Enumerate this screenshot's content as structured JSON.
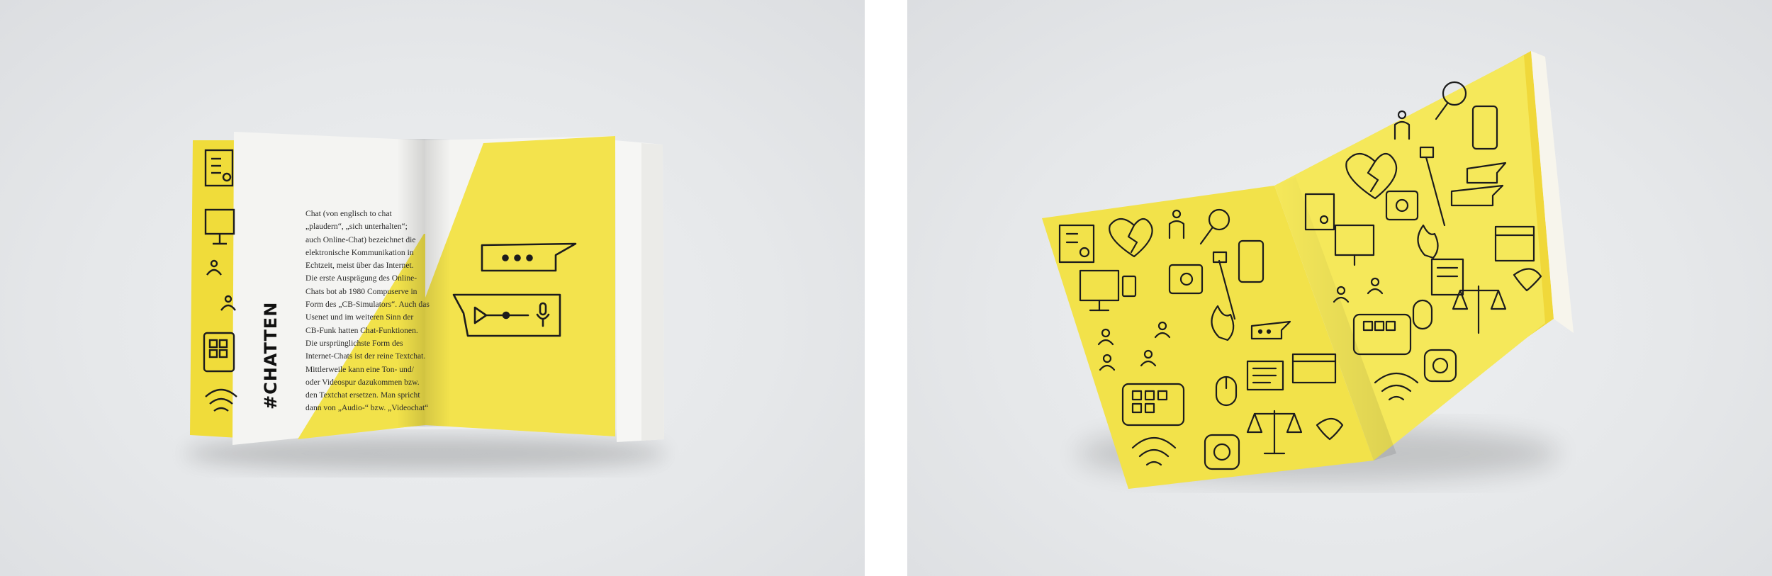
{
  "left_photo": {
    "heading": "#CHATTEN",
    "body_text": "Chat (von englisch to chat\n„plaudern“, „sich unterhalten“;\nauch Online-Chat) bezeichnet die\nelektronische Kommunikation in\nEchtzeit, meist über das Internet.\nDie erste Ausprägung des Online-\nChats bot ab 1980 Compuserve in\nForm des „CB-Simulators“. Auch das\nUsenet und im weiteren Sinn der\nCB-Funk hatten Chat-Funktionen.\nDie ursprünglichste Form des\nInternet-Chats ist der reine Textchat.\nMittlerweile kann eine Ton- und/\noder Videospur dazukommen bzw.\nden Textchat ersetzen. Man spricht\ndann von „Audio-“ bzw. „Videochat“",
    "icons": [
      "text-bubble-icon",
      "voice-message-icon"
    ]
  },
  "right_photo": {
    "icons": [
      "id-card-icon",
      "broken-heart-icon",
      "person-icon",
      "magnifier-icon",
      "smartphone-icon",
      "selfie-stick-icon",
      "computer-icon",
      "like-icon",
      "flame-icon",
      "chat-bubble-icon",
      "people-icon",
      "mouse-icon",
      "document-icon",
      "browser-icon",
      "justice-scale-icon",
      "twitter-bird-icon",
      "tablet-apps-icon",
      "instagram-icon",
      "wifi-icon"
    ]
  },
  "colors": {
    "yellow": "#f2e24a",
    "yellow_light": "#f5ea6a",
    "white_page": "#f4f4f2",
    "background": "#e7e9eb",
    "ink": "#1c1c1c"
  }
}
